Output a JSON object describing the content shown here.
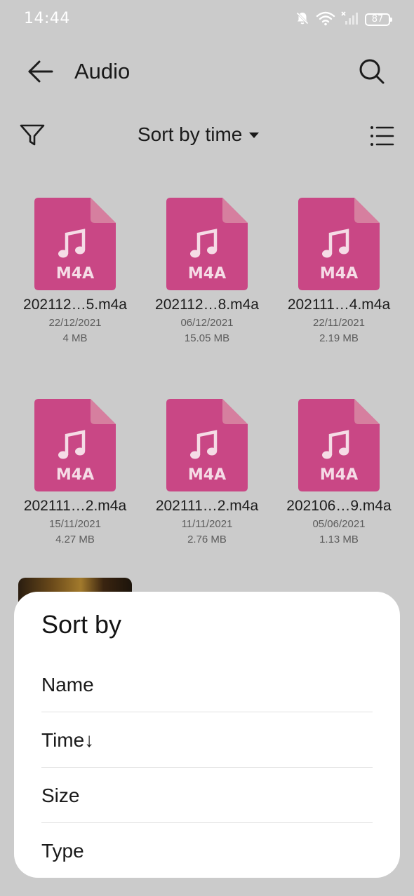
{
  "status_bar": {
    "time": "14:44",
    "battery": "87",
    "icons": [
      "bell-muted-icon",
      "wifi-icon",
      "cellular-no-signal-icon",
      "battery-icon"
    ]
  },
  "app_bar": {
    "title": "Audio",
    "back_icon": "arrow-left-icon",
    "search_icon": "search-icon"
  },
  "toolbar": {
    "sort_label": "Sort by time",
    "filter_icon": "funnel-icon",
    "list_view_icon": "list-view-icon"
  },
  "colors": {
    "background": "#cbcbcb",
    "file_icon": "#c94785",
    "file_icon_fold": "#d67f9f",
    "sheet": "#ffffff"
  },
  "files": [
    {
      "name": "202112…5.m4a",
      "date": "22/12/2021",
      "size": "4 MB",
      "badge": "M4A"
    },
    {
      "name": "202112…8.m4a",
      "date": "06/12/2021",
      "size": "15.05 MB",
      "badge": "M4A"
    },
    {
      "name": "202111…4.m4a",
      "date": "22/11/2021",
      "size": "2.19 MB",
      "badge": "M4A"
    },
    {
      "name": "202111…2.m4a",
      "date": "15/11/2021",
      "size": "4.27 MB",
      "badge": "M4A"
    },
    {
      "name": "202111…2.m4a",
      "date": "11/11/2021",
      "size": "2.76 MB",
      "badge": "M4A"
    },
    {
      "name": "202106…9.m4a",
      "date": "05/06/2021",
      "size": "1.13 MB",
      "badge": "M4A"
    }
  ],
  "sort_sheet": {
    "title": "Sort by",
    "options": [
      {
        "label": "Name"
      },
      {
        "label": "Time↓",
        "selected": true
      },
      {
        "label": "Size"
      },
      {
        "label": "Type"
      }
    ]
  }
}
